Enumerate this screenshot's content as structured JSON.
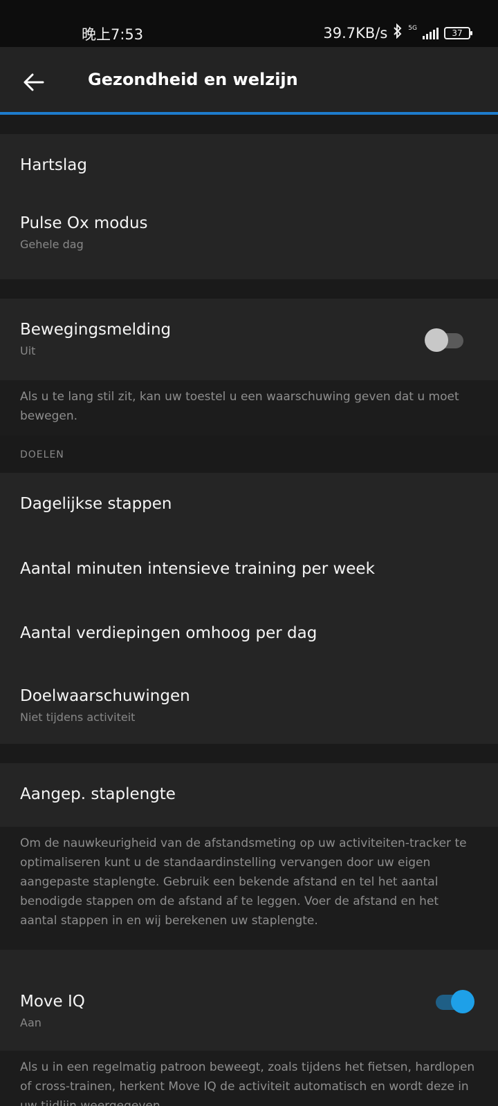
{
  "status_bar": {
    "time": "晚上7:53",
    "network_speed": "39.7KB/s",
    "network_type": "5G",
    "battery": "37"
  },
  "app_bar": {
    "title": "Gezondheid en welzijn"
  },
  "settings": {
    "heart_rate": {
      "label": "Hartslag"
    },
    "pulse_ox": {
      "label": "Pulse Ox modus",
      "value": "Gehele dag"
    },
    "move_alert": {
      "label": "Bewegingsmelding",
      "value": "Uit",
      "enabled": false,
      "description": "Als u te lang stil zit, kan uw toestel u een waarschuwing geven dat u moet bewegen."
    },
    "goals_header": "DOELEN",
    "daily_steps": {
      "label": "Dagelijkse stappen"
    },
    "intensity_minutes": {
      "label": "Aantal minuten intensieve training per week"
    },
    "floors_climbed": {
      "label": "Aantal verdiepingen omhoog per dag"
    },
    "goal_alerts": {
      "label": "Doelwaarschuwingen",
      "value": "Niet tijdens activiteit"
    },
    "stride_length": {
      "label": "Aangep. staplengte",
      "description": "Om de nauwkeurigheid van de afstandsmeting op uw activiteiten-tracker te optimaliseren kunt u de standaardinstelling vervangen door uw eigen aangepaste staplengte. Gebruik een bekende afstand en tel het aantal benodigde stappen om de afstand af te leggen. Voer de afstand en het aantal stappen in en wij berekenen uw staplengte."
    },
    "move_iq": {
      "label": "Move IQ",
      "value": "Aan",
      "enabled": true,
      "description": "Als u in een regelmatig patroon beweegt, zoals tijdens het fietsen, hardlopen of cross-trainen, herkent Move IQ de activiteit automatisch en wordt deze in uw tijdlijn weergegeven."
    }
  },
  "colors": {
    "accent": "#1e7ccd",
    "toggle_on": "#1ea0e8",
    "background": "#1a1a1a",
    "card": "#252525"
  }
}
